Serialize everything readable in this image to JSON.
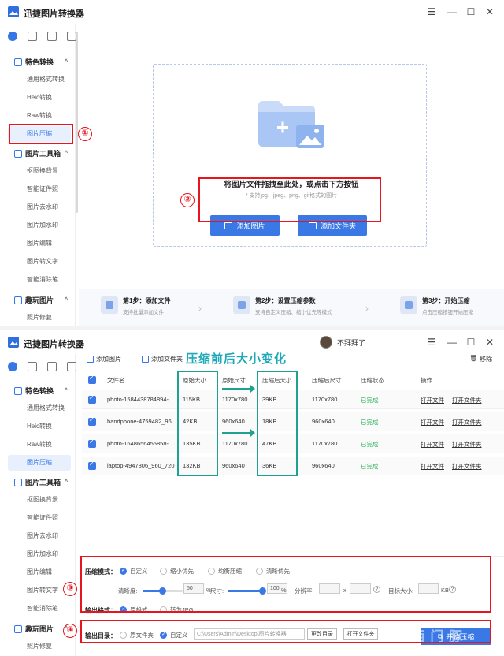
{
  "app": {
    "title": "迅捷图片转换器"
  },
  "window_controls": {
    "menu": "☰",
    "minimize": "—",
    "maximize": "☐",
    "close": "✕"
  },
  "sidebar": {
    "sections": [
      {
        "label": "特色转换",
        "caret": "^",
        "items": [
          "通用格式转换",
          "Heic转换",
          "Raw转换",
          "图片压缩"
        ]
      },
      {
        "label": "图片工具箱",
        "caret": "^",
        "items": [
          "抠图换背景",
          "智能证件照",
          "图片去水印",
          "图片加水印",
          "图片编辑",
          "图片转文字",
          "智能消除笔"
        ]
      },
      {
        "label": "趣玩图片",
        "caret": "^",
        "items": [
          "照片修复"
        ]
      }
    ],
    "selected": "图片压缩"
  },
  "upload": {
    "hint": "将图片文件拖拽至此处，或点击下方按钮",
    "sub": "* 支持jpg、jpeg、png、gif格式的图片",
    "add_image": "添加图片",
    "add_folder": "添加文件夹"
  },
  "steps": [
    {
      "title": "第1步：添加文件",
      "desc": "支持批量添加文件"
    },
    {
      "title": "第2步：设置压缩参数",
      "desc": "支持自定义压缩、缩小优先等模式"
    },
    {
      "title": "第3步：开始压缩",
      "desc": "点击压缩按钮开始压缩"
    }
  ],
  "annotations": {
    "c1": "①",
    "c2": "②",
    "c3": "③",
    "c4": "④",
    "headline": "压缩前后大小变化"
  },
  "user": {
    "name": "不拜拜了"
  },
  "toolbar2": {
    "add_image": "添加图片",
    "add_folder": "添加文件夹",
    "remove": "移除"
  },
  "table": {
    "headers": [
      "文件名",
      "原始大小",
      "原始尺寸",
      "压缩后大小",
      "压缩后尺寸",
      "压缩状态",
      "操作"
    ],
    "rows": [
      {
        "name": "photo-1584438784894-...",
        "orig_size": "115KB",
        "orig_dim": "1170x780",
        "new_size": "39KB",
        "new_dim": "1170x780",
        "status": "已完成",
        "op1": "打开文件",
        "op2": "打开文件夹"
      },
      {
        "name": "handphone-4759482_96...",
        "orig_size": "42KB",
        "orig_dim": "960x640",
        "new_size": "18KB",
        "new_dim": "960x640",
        "status": "已完成",
        "op1": "打开文件",
        "op2": "打开文件夹"
      },
      {
        "name": "photo-1648656455858-...",
        "orig_size": "135KB",
        "orig_dim": "1170x780",
        "new_size": "47KB",
        "new_dim": "1170x780",
        "status": "已完成",
        "op1": "打开文件",
        "op2": "打开文件夹"
      },
      {
        "name": "laptop-4947806_960_720",
        "orig_size": "132KB",
        "orig_dim": "960x640",
        "new_size": "36KB",
        "new_dim": "960x640",
        "status": "已完成",
        "op1": "打开文件",
        "op2": "打开文件夹"
      }
    ]
  },
  "settings": {
    "mode_label": "压缩模式：",
    "modes": [
      "自定义",
      "缩小优先",
      "均衡压缩",
      "清晰优先"
    ],
    "mode_selected": "自定义",
    "clarity_label": "清晰度:",
    "clarity_value": "50",
    "percent": "%",
    "size_label": "尺寸:",
    "size_value": "100",
    "resolution_label": "分辨率:",
    "x": "x",
    "target_label": "目标大小:",
    "kb": "KB",
    "format_label": "输出格式：",
    "formats": [
      "原格式",
      "转为JPG"
    ],
    "format_selected": "原格式",
    "dir_label": "输出目录：",
    "dirs": [
      "原文件夹",
      "自定义"
    ],
    "dir_selected": "自定义",
    "path": "C:\\Users\\Admin\\Desktop\\图片转换器",
    "change_dir": "更改目录",
    "open_folder": "打开文件夹",
    "start": "开始压缩"
  },
  "colors": {
    "accent": "#3a78e6",
    "red": "#e8141e",
    "teal": "#1ea18e",
    "done": "#2eb15c"
  }
}
